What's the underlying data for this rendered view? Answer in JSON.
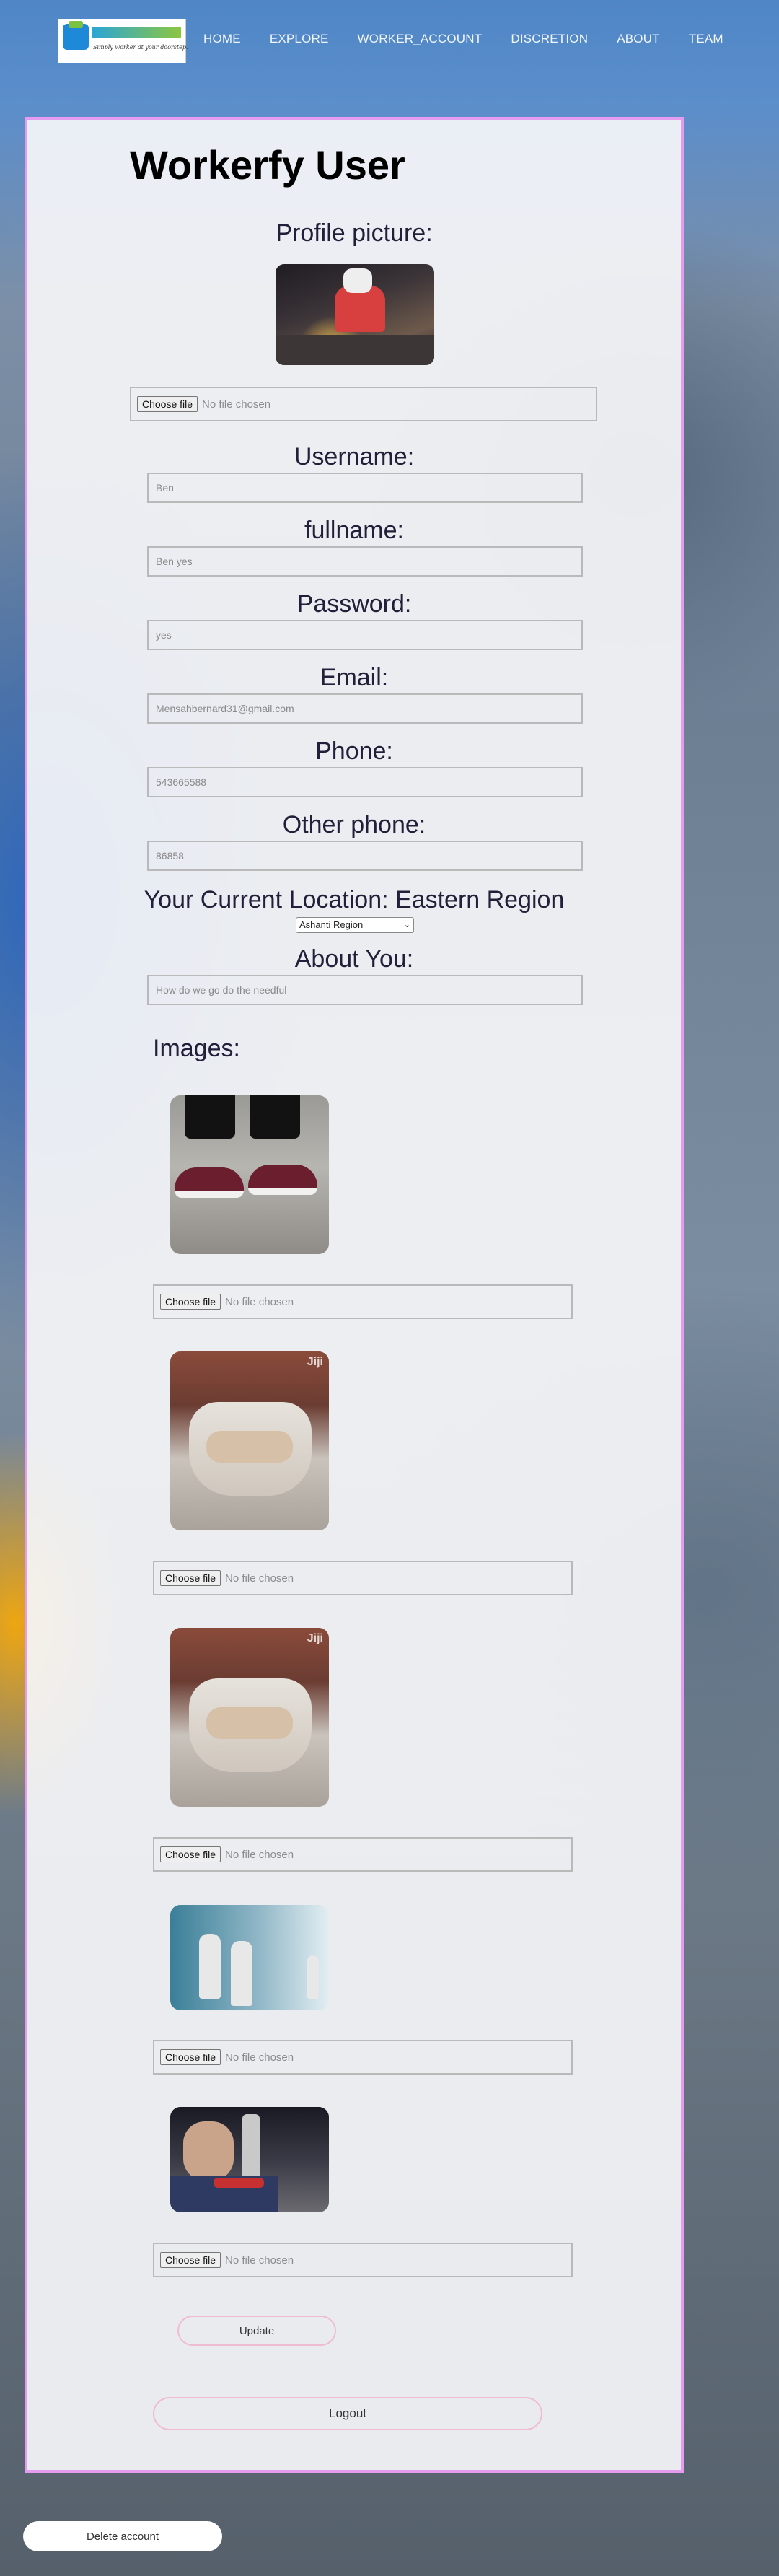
{
  "nav": {
    "logo_tagline": "Simply worker at your doorstep.",
    "links": [
      "HOME",
      "EXPLORE",
      "WORKER_ACCOUNT",
      "DISCRETION",
      "ABOUT",
      "TEAM"
    ]
  },
  "page": {
    "title": "Workerfy User"
  },
  "profile": {
    "picture_label": "Profile picture:",
    "file_button": "Choose file",
    "file_status": "No file chosen"
  },
  "fields": {
    "username": {
      "label": "Username:",
      "value": "Ben"
    },
    "fullname": {
      "label": "fullname:",
      "value": "Ben yes"
    },
    "password": {
      "label": "Password:",
      "value": "yes"
    },
    "email": {
      "label": "Email:",
      "value": "Mensahbernard31@gmail.com"
    },
    "phone": {
      "label": "Phone:",
      "value": "543665588"
    },
    "other_phone": {
      "label": "Other phone:",
      "value": "86858"
    },
    "location": {
      "label": "Your Current Location: Eastern Region",
      "selected": "Ashanti Region"
    },
    "about": {
      "label": "About You:",
      "value": "How do we go do the needful"
    }
  },
  "images": {
    "label": "Images:",
    "items": [
      {
        "file_button": "Choose file",
        "file_status": "No file chosen"
      },
      {
        "file_button": "Choose file",
        "file_status": "No file chosen"
      },
      {
        "file_button": "Choose file",
        "file_status": "No file chosen"
      },
      {
        "file_button": "Choose file",
        "file_status": "No file chosen"
      },
      {
        "file_button": "Choose file",
        "file_status": "No file chosen"
      }
    ],
    "watermark": "Jiji"
  },
  "actions": {
    "update": "Update",
    "logout": "Logout",
    "delete": "Delete account"
  },
  "colors": {
    "card_border": "#e59bf0",
    "button_border": "#f0bcd0"
  }
}
